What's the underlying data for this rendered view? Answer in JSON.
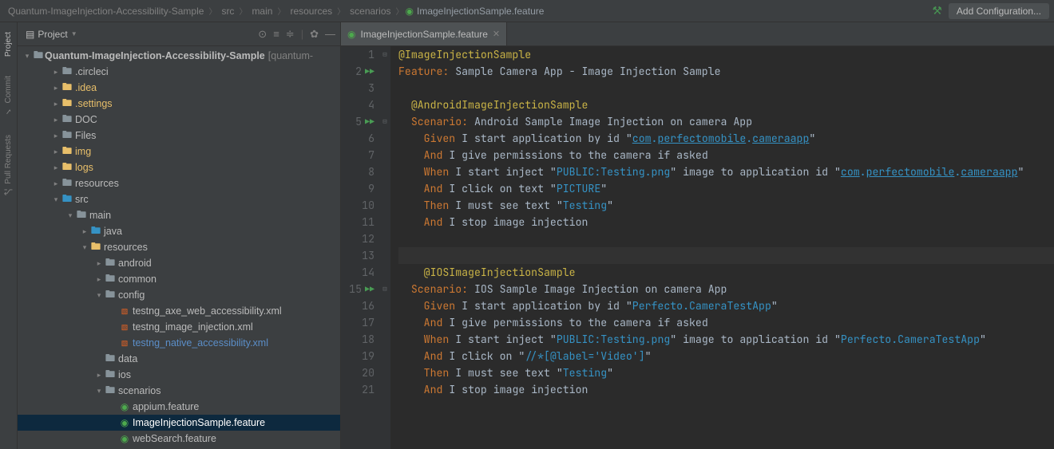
{
  "breadcrumbs": [
    "Quantum-ImageInjection-Accessibility-Sample",
    "src",
    "main",
    "resources",
    "scenarios"
  ],
  "breadcrumb_file": "ImageInjectionSample.feature",
  "add_config": "Add Configuration...",
  "rail": {
    "project": "Project",
    "commit": "Commit",
    "pull": "Pull Requests"
  },
  "project_header": "Project",
  "tree": {
    "root_name": "Quantum-ImageInjection-Accessibility-Sample",
    "root_ctx": "[quantum-",
    "items": [
      {
        "depth": 1,
        "arrow": ">",
        "icon": "folder",
        "name": ".circleci",
        "cls": ""
      },
      {
        "depth": 1,
        "arrow": ">",
        "icon": "folder-ex",
        "name": ".idea",
        "cls": "text-exclude"
      },
      {
        "depth": 1,
        "arrow": ">",
        "icon": "folder-ex",
        "name": ".settings",
        "cls": "text-exclude"
      },
      {
        "depth": 1,
        "arrow": ">",
        "icon": "folder",
        "name": "DOC",
        "cls": ""
      },
      {
        "depth": 1,
        "arrow": ">",
        "icon": "folder",
        "name": "Files",
        "cls": ""
      },
      {
        "depth": 1,
        "arrow": ">",
        "icon": "folder-ex",
        "name": "img",
        "cls": "text-exclude"
      },
      {
        "depth": 1,
        "arrow": ">",
        "icon": "folder-ex",
        "name": "logs",
        "cls": "text-exclude"
      },
      {
        "depth": 1,
        "arrow": ">",
        "icon": "folder",
        "name": "resources",
        "cls": ""
      },
      {
        "depth": 1,
        "arrow": "v",
        "icon": "folder-src",
        "name": "src",
        "cls": ""
      },
      {
        "depth": 2,
        "arrow": "v",
        "icon": "folder",
        "name": "main",
        "cls": ""
      },
      {
        "depth": 3,
        "arrow": ">",
        "icon": "folder-src",
        "name": "java",
        "cls": ""
      },
      {
        "depth": 3,
        "arrow": "v",
        "icon": "folder-res",
        "name": "resources",
        "cls": ""
      },
      {
        "depth": 4,
        "arrow": ">",
        "icon": "folder",
        "name": "android",
        "cls": ""
      },
      {
        "depth": 4,
        "arrow": ">",
        "icon": "folder",
        "name": "common",
        "cls": ""
      },
      {
        "depth": 4,
        "arrow": "v",
        "icon": "folder",
        "name": "config",
        "cls": ""
      },
      {
        "depth": 5,
        "arrow": "",
        "icon": "xml",
        "name": "testng_axe_web_accessibility.xml",
        "cls": ""
      },
      {
        "depth": 5,
        "arrow": "",
        "icon": "xml",
        "name": "testng_image_injection.xml",
        "cls": ""
      },
      {
        "depth": 5,
        "arrow": "",
        "icon": "xml",
        "name": "testng_native_accessibility.xml",
        "cls": "text-highlight"
      },
      {
        "depth": 4,
        "arrow": "",
        "icon": "folder",
        "name": "data",
        "cls": ""
      },
      {
        "depth": 4,
        "arrow": ">",
        "icon": "folder",
        "name": "ios",
        "cls": ""
      },
      {
        "depth": 4,
        "arrow": "v",
        "icon": "folder",
        "name": "scenarios",
        "cls": ""
      },
      {
        "depth": 5,
        "arrow": "",
        "icon": "cuc",
        "name": "appium.feature",
        "cls": ""
      },
      {
        "depth": 5,
        "arrow": "",
        "icon": "cuc",
        "name": "ImageInjectionSample.feature",
        "cls": "",
        "selected": true
      },
      {
        "depth": 5,
        "arrow": "",
        "icon": "cuc",
        "name": "webSearch.feature",
        "cls": ""
      }
    ]
  },
  "editor_tab": "ImageInjectionSample.feature",
  "code": {
    "line_count": 21,
    "run_markers": [
      2,
      5,
      15
    ],
    "fold_markers_minus": [
      1,
      5,
      15
    ],
    "caret_line": 13,
    "lines": [
      "@ImageInjectionSample",
      "Feature: Sample Camera App - Image Injection Sample",
      "",
      "  @AndroidImageInjectionSample",
      "  Scenario: Android Sample Image Injection on camera App",
      "    Given I start application by id \"com.perfectomobile.cameraapp\"",
      "    And I give permissions to the camera if asked",
      "    When I start inject \"PUBLIC:Testing.png\" image to application id \"com.perfectomobile.cameraapp\"",
      "    And I click on text \"PICTURE\"",
      "    Then I must see text \"Testing\"",
      "    And I stop image injection",
      "",
      "",
      "    @IOSImageInjectionSample",
      "  Scenario: IOS Sample Image Injection on camera App",
      "    Given I start application by id \"Perfecto.CameraTestApp\"",
      "    And I give permissions to the camera if asked",
      "    When I start inject \"PUBLIC:Testing.png\" image to application id \"Perfecto.CameraTestApp\"",
      "    And I click on \"//*[@label='Video']\"",
      "    Then I must see text \"Testing\"",
      "    And I stop image injection"
    ]
  }
}
